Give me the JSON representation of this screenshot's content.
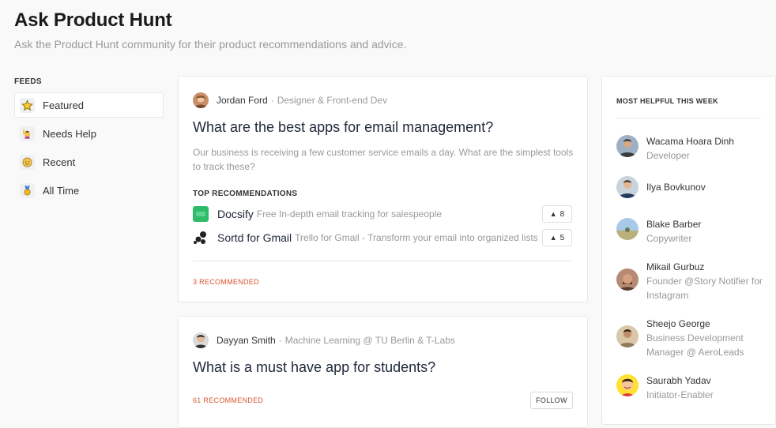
{
  "header": {
    "title": "Ask Product Hunt",
    "subtitle": "Ask the Product Hunt community for their product recommendations and advice."
  },
  "sidebar": {
    "heading": "FEEDS",
    "items": [
      {
        "label": "Featured",
        "icon": "star-icon",
        "active": true
      },
      {
        "label": "Needs Help",
        "icon": "raising-hand-icon",
        "active": false
      },
      {
        "label": "Recent",
        "icon": "baby-face-icon",
        "active": false
      },
      {
        "label": "All Time",
        "icon": "medal-icon",
        "active": false
      }
    ]
  },
  "posts": [
    {
      "author": "Jordan Ford",
      "role": "Designer & Front-end Dev",
      "question": "What are the best apps for email management?",
      "body": "Our business is receiving a few customer service emails a day. What are the simplest tools to track these?",
      "recommendations_heading": "TOP RECOMMENDATIONS",
      "recommendations": [
        {
          "name": "Docsify",
          "tagline": "Free In-depth email tracking for salespeople",
          "votes": "8",
          "logo": "docsify-logo-icon"
        },
        {
          "name": "Sortd for Gmail",
          "tagline": "Trello for Gmail - Transform your email into organized lists",
          "votes": "5",
          "logo": "sortd-logo-icon"
        }
      ],
      "recommended_label": "3 RECOMMENDED"
    },
    {
      "author": "Dayyan Smith",
      "role": "Machine Learning @ TU Berlin & T-Labs",
      "question": "What is a must have app for students?",
      "recommended_label": "61 RECOMMENDED",
      "follow_label": "FOLLOW"
    }
  ],
  "helpful": {
    "heading": "MOST HELPFUL THIS WEEK",
    "users": [
      {
        "name": "Wacama Hoara Dinh",
        "desc": "Developer"
      },
      {
        "name": "Ilya Bovkunov",
        "desc": ""
      },
      {
        "name": "Blake Barber",
        "desc": "Copywriter"
      },
      {
        "name": "Mikail Gurbuz",
        "desc": "Founder @Story Notifier for Instagram"
      },
      {
        "name": "Sheejo George",
        "desc": "Business Development Manager @ AeroLeads"
      },
      {
        "name": "Saurabh Yadav",
        "desc": "Initiator-Enabler"
      }
    ]
  },
  "colors": {
    "accent": "#da552f",
    "background": "#f9f9f9",
    "text_muted": "#999999"
  }
}
